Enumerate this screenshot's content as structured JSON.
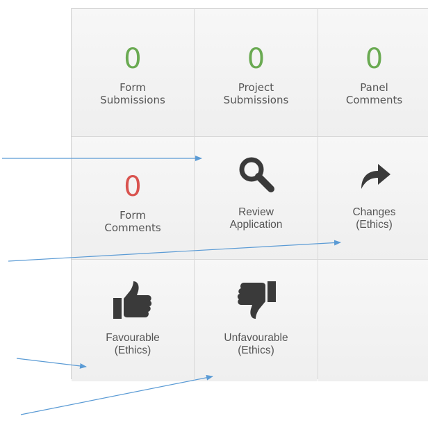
{
  "tiles": {
    "form_submissions": {
      "count": "0",
      "label_line1": "Form",
      "label_line2": "Submissions"
    },
    "project_submissions": {
      "count": "0",
      "label_line1": "Project",
      "label_line2": "Submissions"
    },
    "panel_comments": {
      "count": "0",
      "label_line1": "Panel",
      "label_line2": "Comments"
    },
    "form_comments": {
      "count": "0",
      "label_line1": "Form",
      "label_line2": "Comments"
    },
    "review_application": {
      "label_line1": "Review",
      "label_line2": "Application"
    },
    "changes_ethics": {
      "label_line1": "Changes",
      "label_line2": "(Ethics)"
    },
    "favourable_ethics": {
      "label_line1": "Favourable",
      "label_line2": "(Ethics)"
    },
    "unfavourable_ethics": {
      "label_line1": "Unfavourable",
      "label_line2": "(Ethics)"
    }
  },
  "colors": {
    "count_green": "#6aaa52",
    "count_red": "#d9534f",
    "icon_dark": "#3a3a3a",
    "arrow_blue": "#5b9bd5"
  },
  "icons": [
    "search-icon",
    "share-arrow-icon",
    "thumbs-up-icon",
    "thumbs-down-icon"
  ]
}
